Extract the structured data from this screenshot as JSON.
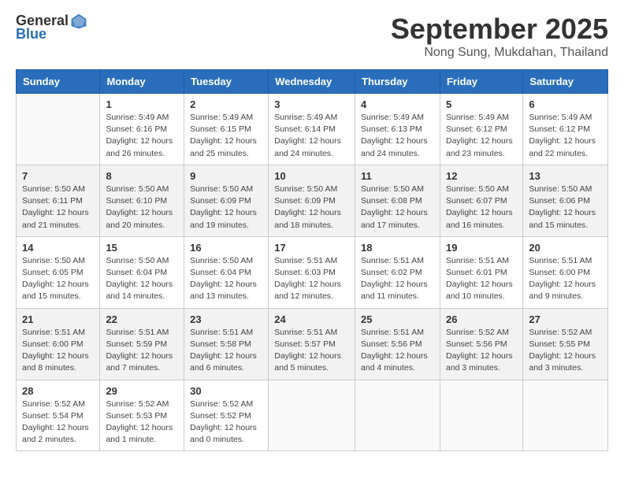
{
  "logo": {
    "text_general": "General",
    "text_blue": "Blue"
  },
  "title": {
    "month": "September 2025",
    "location": "Nong Sung, Mukdahan, Thailand"
  },
  "weekdays": [
    "Sunday",
    "Monday",
    "Tuesday",
    "Wednesday",
    "Thursday",
    "Friday",
    "Saturday"
  ],
  "weeks": [
    [
      {
        "day": "",
        "info": ""
      },
      {
        "day": "1",
        "info": "Sunrise: 5:49 AM\nSunset: 6:16 PM\nDaylight: 12 hours\nand 26 minutes."
      },
      {
        "day": "2",
        "info": "Sunrise: 5:49 AM\nSunset: 6:15 PM\nDaylight: 12 hours\nand 25 minutes."
      },
      {
        "day": "3",
        "info": "Sunrise: 5:49 AM\nSunset: 6:14 PM\nDaylight: 12 hours\nand 24 minutes."
      },
      {
        "day": "4",
        "info": "Sunrise: 5:49 AM\nSunset: 6:13 PM\nDaylight: 12 hours\nand 24 minutes."
      },
      {
        "day": "5",
        "info": "Sunrise: 5:49 AM\nSunset: 6:12 PM\nDaylight: 12 hours\nand 23 minutes."
      },
      {
        "day": "6",
        "info": "Sunrise: 5:49 AM\nSunset: 6:12 PM\nDaylight: 12 hours\nand 22 minutes."
      }
    ],
    [
      {
        "day": "7",
        "info": "Sunrise: 5:50 AM\nSunset: 6:11 PM\nDaylight: 12 hours\nand 21 minutes."
      },
      {
        "day": "8",
        "info": "Sunrise: 5:50 AM\nSunset: 6:10 PM\nDaylight: 12 hours\nand 20 minutes."
      },
      {
        "day": "9",
        "info": "Sunrise: 5:50 AM\nSunset: 6:09 PM\nDaylight: 12 hours\nand 19 minutes."
      },
      {
        "day": "10",
        "info": "Sunrise: 5:50 AM\nSunset: 6:09 PM\nDaylight: 12 hours\nand 18 minutes."
      },
      {
        "day": "11",
        "info": "Sunrise: 5:50 AM\nSunset: 6:08 PM\nDaylight: 12 hours\nand 17 minutes."
      },
      {
        "day": "12",
        "info": "Sunrise: 5:50 AM\nSunset: 6:07 PM\nDaylight: 12 hours\nand 16 minutes."
      },
      {
        "day": "13",
        "info": "Sunrise: 5:50 AM\nSunset: 6:06 PM\nDaylight: 12 hours\nand 15 minutes."
      }
    ],
    [
      {
        "day": "14",
        "info": "Sunrise: 5:50 AM\nSunset: 6:05 PM\nDaylight: 12 hours\nand 15 minutes."
      },
      {
        "day": "15",
        "info": "Sunrise: 5:50 AM\nSunset: 6:04 PM\nDaylight: 12 hours\nand 14 minutes."
      },
      {
        "day": "16",
        "info": "Sunrise: 5:50 AM\nSunset: 6:04 PM\nDaylight: 12 hours\nand 13 minutes."
      },
      {
        "day": "17",
        "info": "Sunrise: 5:51 AM\nSunset: 6:03 PM\nDaylight: 12 hours\nand 12 minutes."
      },
      {
        "day": "18",
        "info": "Sunrise: 5:51 AM\nSunset: 6:02 PM\nDaylight: 12 hours\nand 11 minutes."
      },
      {
        "day": "19",
        "info": "Sunrise: 5:51 AM\nSunset: 6:01 PM\nDaylight: 12 hours\nand 10 minutes."
      },
      {
        "day": "20",
        "info": "Sunrise: 5:51 AM\nSunset: 6:00 PM\nDaylight: 12 hours\nand 9 minutes."
      }
    ],
    [
      {
        "day": "21",
        "info": "Sunrise: 5:51 AM\nSunset: 6:00 PM\nDaylight: 12 hours\nand 8 minutes."
      },
      {
        "day": "22",
        "info": "Sunrise: 5:51 AM\nSunset: 5:59 PM\nDaylight: 12 hours\nand 7 minutes."
      },
      {
        "day": "23",
        "info": "Sunrise: 5:51 AM\nSunset: 5:58 PM\nDaylight: 12 hours\nand 6 minutes."
      },
      {
        "day": "24",
        "info": "Sunrise: 5:51 AM\nSunset: 5:57 PM\nDaylight: 12 hours\nand 5 minutes."
      },
      {
        "day": "25",
        "info": "Sunrise: 5:51 AM\nSunset: 5:56 PM\nDaylight: 12 hours\nand 4 minutes."
      },
      {
        "day": "26",
        "info": "Sunrise: 5:52 AM\nSunset: 5:56 PM\nDaylight: 12 hours\nand 3 minutes."
      },
      {
        "day": "27",
        "info": "Sunrise: 5:52 AM\nSunset: 5:55 PM\nDaylight: 12 hours\nand 3 minutes."
      }
    ],
    [
      {
        "day": "28",
        "info": "Sunrise: 5:52 AM\nSunset: 5:54 PM\nDaylight: 12 hours\nand 2 minutes."
      },
      {
        "day": "29",
        "info": "Sunrise: 5:52 AM\nSunset: 5:53 PM\nDaylight: 12 hours\nand 1 minute."
      },
      {
        "day": "30",
        "info": "Sunrise: 5:52 AM\nSunset: 5:52 PM\nDaylight: 12 hours\nand 0 minutes."
      },
      {
        "day": "",
        "info": ""
      },
      {
        "day": "",
        "info": ""
      },
      {
        "day": "",
        "info": ""
      },
      {
        "day": "",
        "info": ""
      }
    ]
  ],
  "row_classes": [
    "row-white",
    "row-shaded",
    "row-white",
    "row-shaded",
    "row-white"
  ]
}
